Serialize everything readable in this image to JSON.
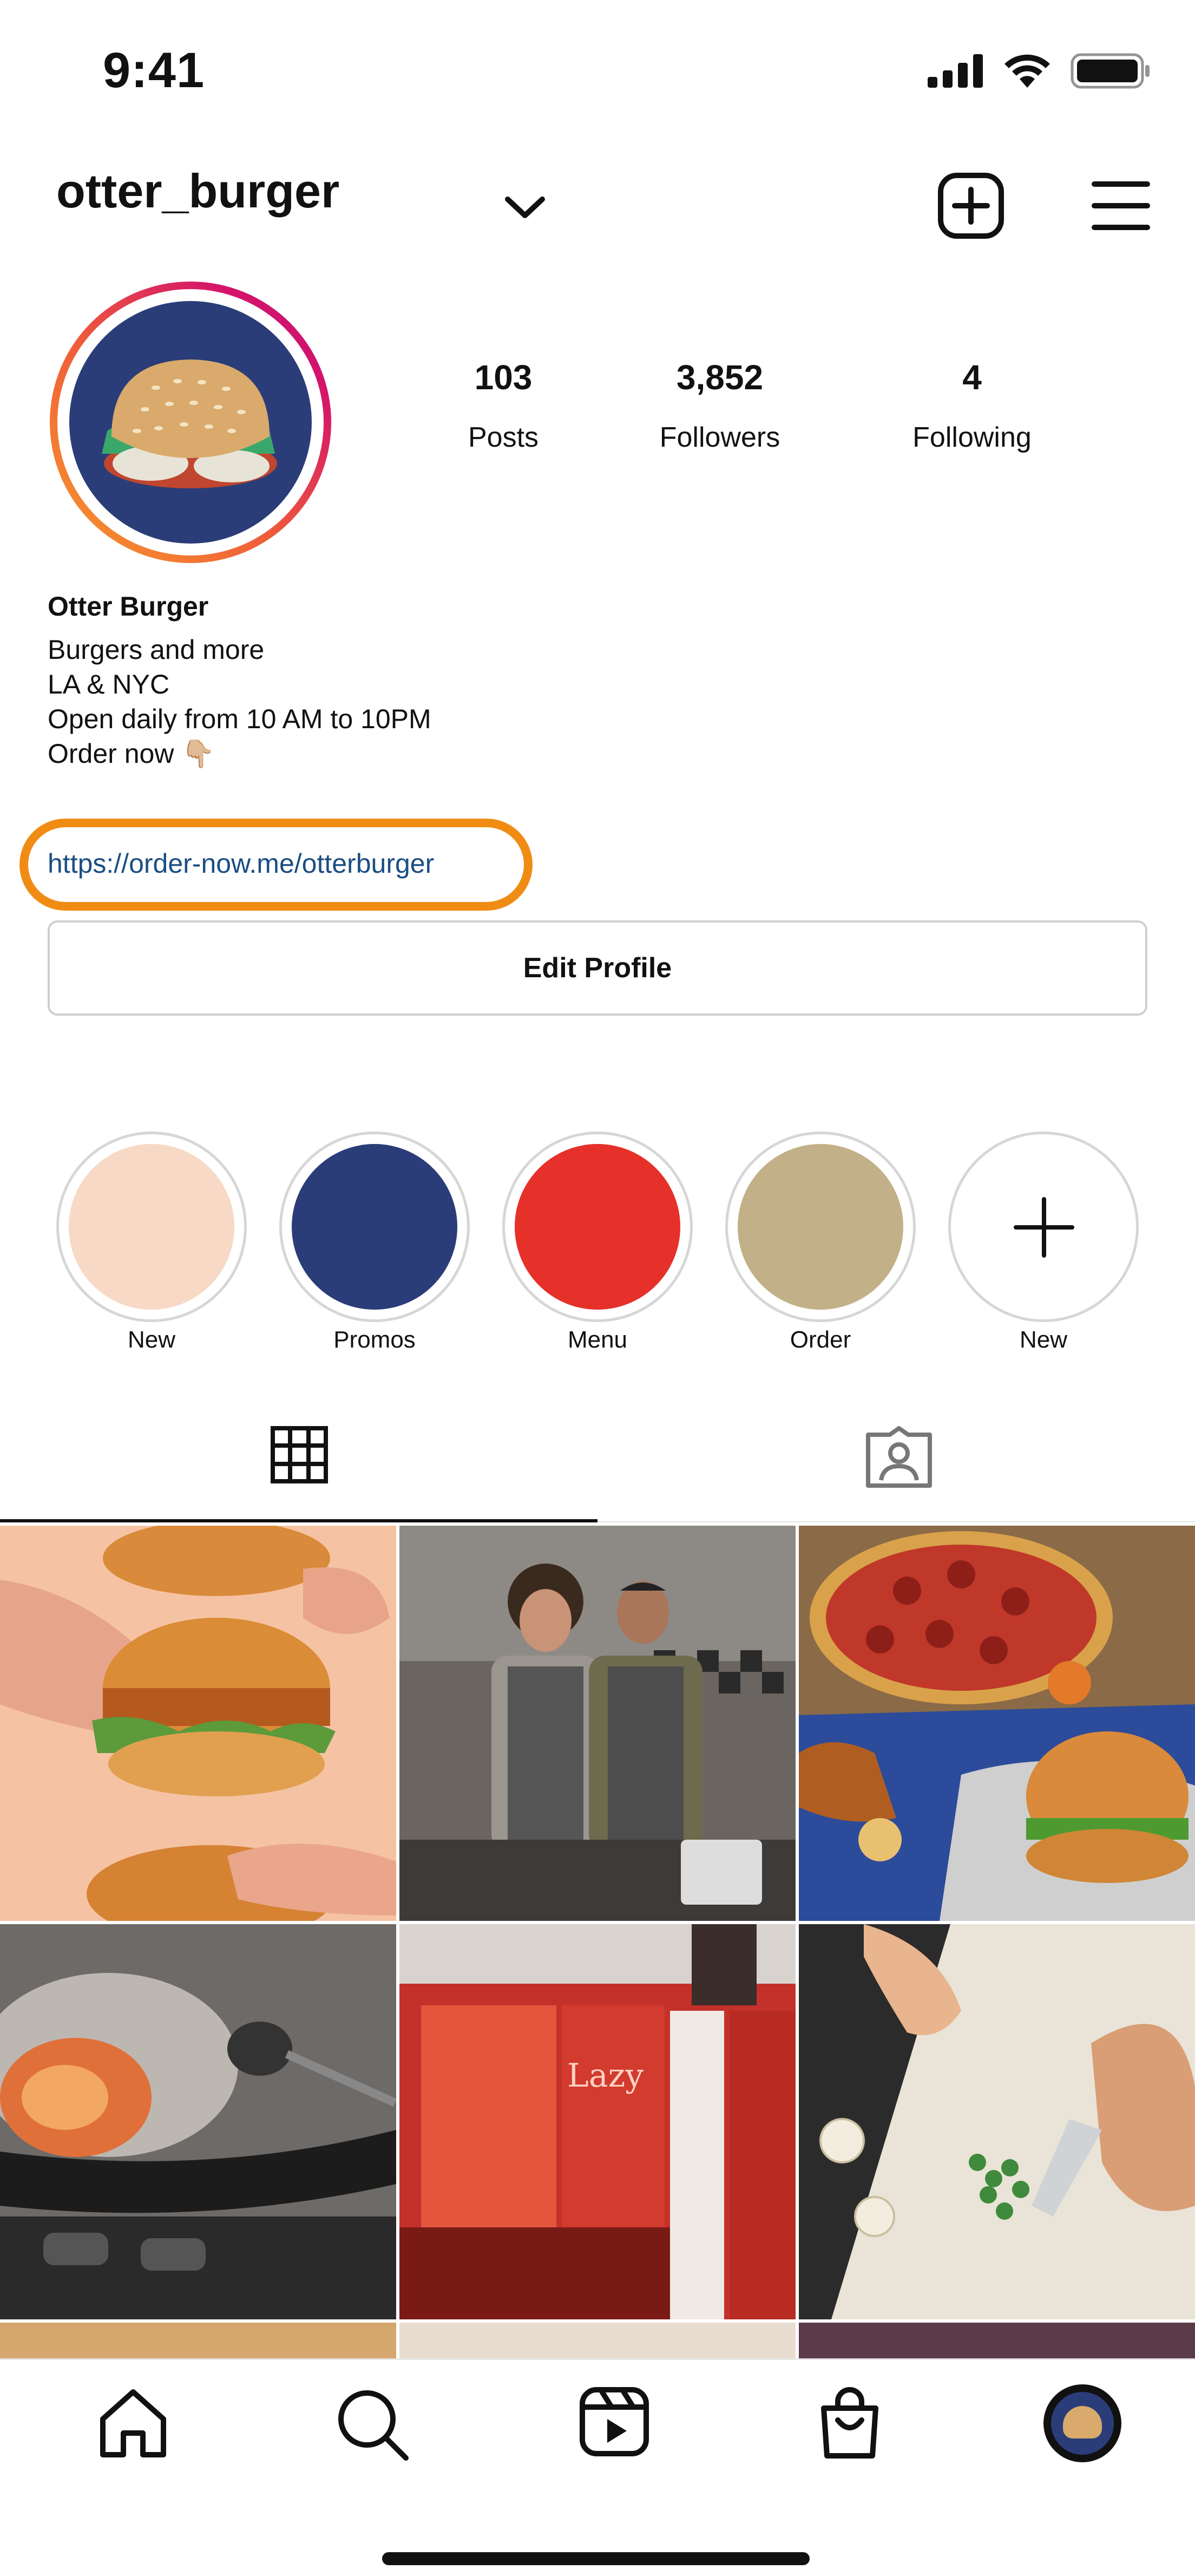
{
  "status_bar": {
    "time": "9:41"
  },
  "header": {
    "username": "otter_burger"
  },
  "stats": [
    {
      "value": "103",
      "label": "Posts"
    },
    {
      "value": "3,852",
      "label": "Followers"
    },
    {
      "value": "4",
      "label": "Following"
    }
  ],
  "bio": {
    "name": "Otter Burger",
    "lines": [
      "Burgers and more",
      "LA & NYC",
      "Open daily from 10 AM to 10PM",
      "Order now 👇🏼"
    ],
    "link": "https://order-now.me/otterburger"
  },
  "edit_profile_label": "Edit Profile",
  "highlights": [
    {
      "label": "New",
      "color": "#f7d9c5"
    },
    {
      "label": "Promos",
      "color": "#2b3d78"
    },
    {
      "label": "Menu",
      "color": "#e6302a"
    },
    {
      "label": "Order",
      "color": "#c2b188"
    },
    {
      "label": "New",
      "icon": "plus-icon"
    }
  ],
  "colors": {
    "accent_ring": "#f08c13",
    "link": "#1a4e83",
    "brand_navy": "#2b3d78"
  },
  "tabs": [
    "grid-icon",
    "tagged-icon"
  ],
  "posts": [
    "burger-sandwiches-hands",
    "two-chefs-smiling",
    "pizza-and-burger-table",
    "wok-flames-steam",
    "lazy-neon-storefront",
    "chopping-scallions"
  ],
  "bottom_nav": [
    "home-icon",
    "search-icon",
    "reels-icon",
    "shop-icon",
    "profile-avatar"
  ]
}
